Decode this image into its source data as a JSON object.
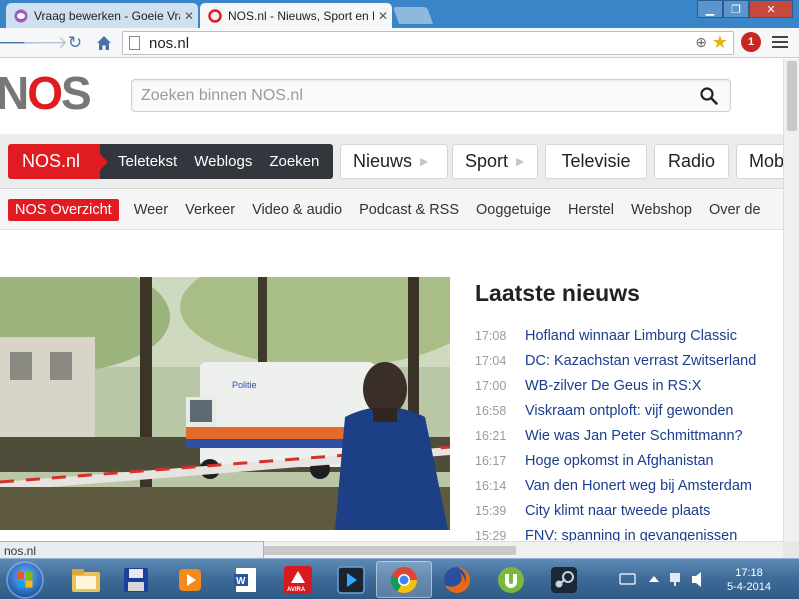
{
  "browser": {
    "tabs": [
      {
        "title": "Vraag bewerken - Goeie Vraag",
        "active": false
      },
      {
        "title": "NOS.nl - Nieuws, Sport en Evenementen",
        "active": true
      }
    ],
    "url": "nos.nl",
    "extension_badge": "1"
  },
  "site": {
    "logo_text_left": "N",
    "logo_text_o": "O",
    "logo_text_right": "S",
    "search_placeholder": "Zoeken binnen NOS.nl",
    "brand": "NOS.nl",
    "brand_links": [
      "Teletekst",
      "Weblogs",
      "Zoeken"
    ],
    "channels": [
      "Nieuws",
      "Sport",
      "Televisie",
      "Radio",
      "Mob"
    ],
    "subnav": [
      "NOS Overzicht",
      "Weer",
      "Verkeer",
      "Video & audio",
      "Podcast & RSS",
      "Ooggetuige",
      "Herstel",
      "Webshop",
      "Over de"
    ],
    "news_title": "Laatste nieuws",
    "news": [
      {
        "time": "17:08",
        "headline": "Hofland winnaar Limburg Classic"
      },
      {
        "time": "17:04",
        "headline": "DC: Kazachstan verrast Zwitserland"
      },
      {
        "time": "17:00",
        "headline": "WB-zilver De Geus in RS:X"
      },
      {
        "time": "16:58",
        "headline": "Viskraam ontploft: vijf gewonden"
      },
      {
        "time": "16:21",
        "headline": "Wie was Jan Peter Schmittmann?"
      },
      {
        "time": "16:17",
        "headline": "Hoge opkomst in Afghanistan"
      },
      {
        "time": "16:14",
        "headline": "Van den Honert weg bij Amsterdam"
      },
      {
        "time": "15:39",
        "headline": "City klimt naar tweede plaats"
      },
      {
        "time": "15:29",
        "headline": "FNV: spanning in gevangenissen"
      }
    ],
    "hero_van_text": "Politie"
  },
  "statusbar": "nos.nl",
  "taskbar": {
    "clock_time": "17:18",
    "clock_date": "5-4-2014",
    "avira_label": "AVIRA",
    "icons": [
      "folder-icon",
      "floppy-icon",
      "media-player-icon",
      "word-icon",
      "avira-icon",
      "video-player-icon",
      "chrome-icon",
      "firefox-icon",
      "utorrent-icon",
      "steam-icon"
    ]
  },
  "colors": {
    "nos_red": "#e01c22",
    "link_blue": "#1a3d8f",
    "dark_bar": "#33363d"
  }
}
